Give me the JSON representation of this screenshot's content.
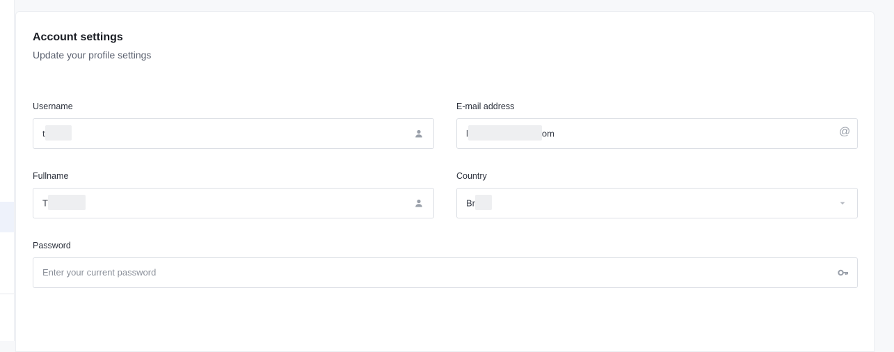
{
  "page": {
    "title": "Account settings",
    "subtitle": "Update your profile settings"
  },
  "form": {
    "username": {
      "label": "Username",
      "value_start": "t",
      "value_end": "",
      "icon": "user-icon"
    },
    "email": {
      "label": "E-mail address",
      "value_start": "l",
      "value_end": "om",
      "icon": "at-icon",
      "icon_glyph": "@"
    },
    "fullname": {
      "label": "Fullname",
      "value_start": "T",
      "value_end": "",
      "icon": "user-icon"
    },
    "country": {
      "label": "Country",
      "value_start": "Br",
      "value_end": "",
      "icon": "chevron-down-icon"
    },
    "password": {
      "label": "Password",
      "placeholder": "Enter your current password",
      "icon": "key-icon"
    }
  }
}
